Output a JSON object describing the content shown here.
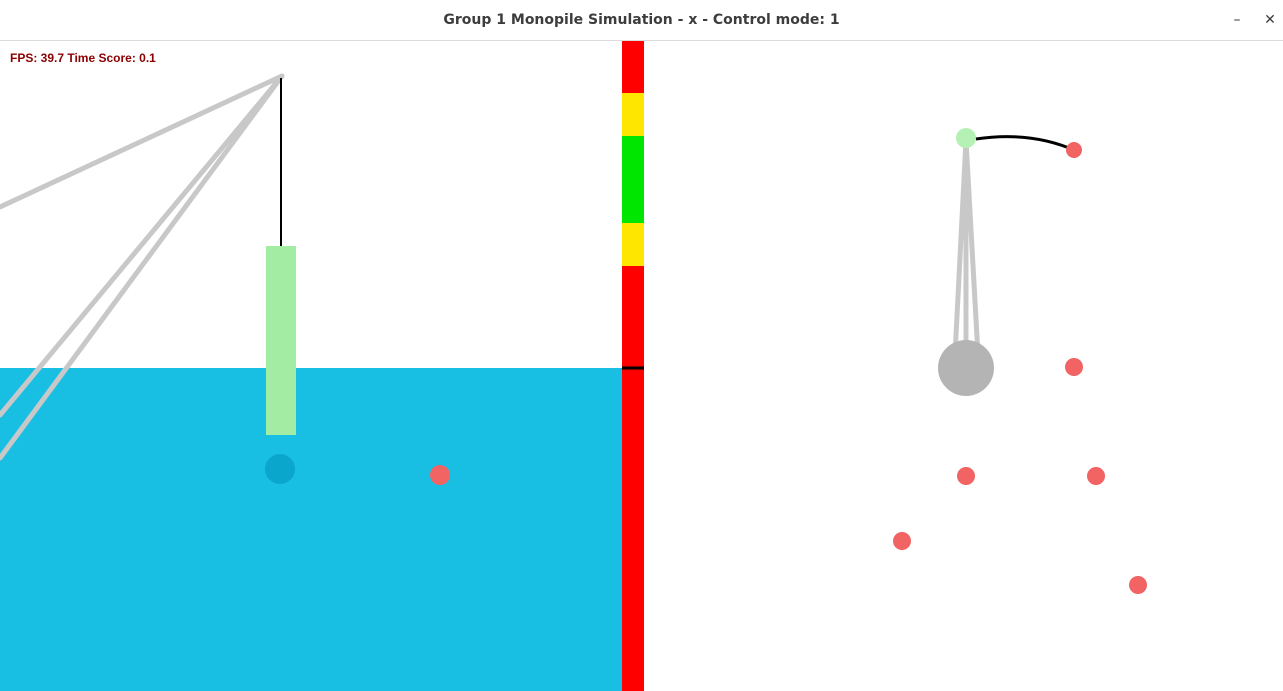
{
  "window": {
    "title": "Group 1 Monopile Simulation - x - Control mode: 1",
    "minimize_symbol": "–",
    "close_symbol": "✕"
  },
  "hud": {
    "text": "FPS: 39.7 Time Score: 0.1"
  },
  "colors": {
    "water": "#19bfe3",
    "monopile": "#a3eca3",
    "crane_boom": "#c8c8c8",
    "cable": "#000000",
    "target_point": "#f26363",
    "pile_tip_marker": "#0aa6cc",
    "gauge_red": "#ff0000",
    "gauge_yellow": "#ffe600",
    "gauge_green": "#00e600",
    "topview_base": "#b4b4b4",
    "topview_hook": "#b5f0b5",
    "hud_text": "#8b0000"
  }
}
